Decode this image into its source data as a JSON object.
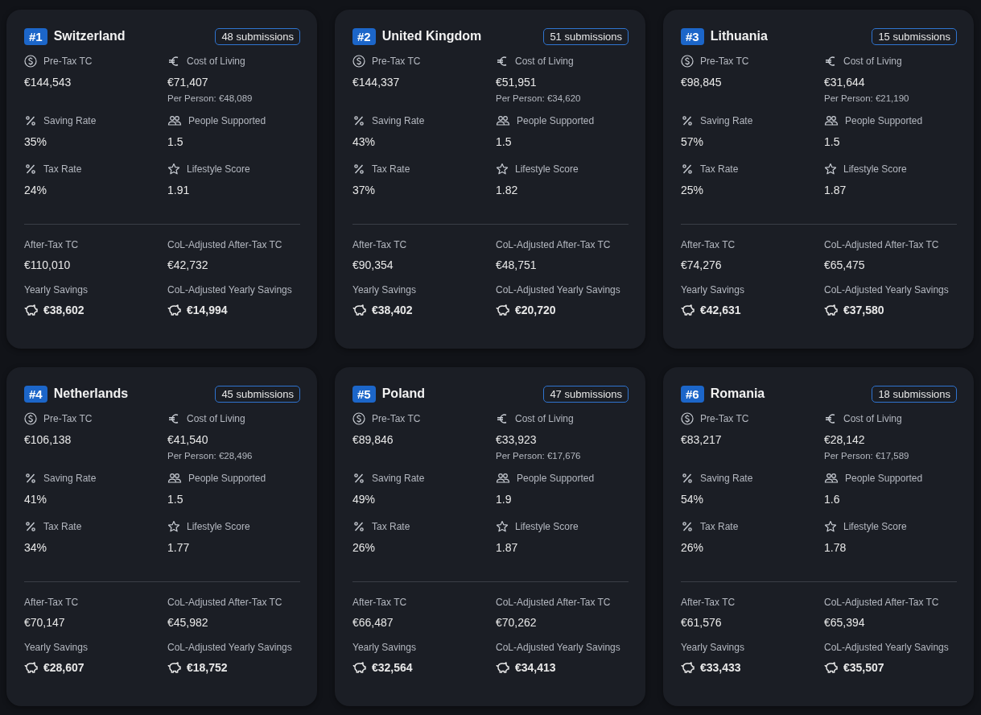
{
  "cards": [
    {
      "rank": "#1",
      "country": "Switzerland",
      "submissions": "48 submissions",
      "metrics": [
        {
          "kind": "dollar",
          "label": "Pre-Tax TC",
          "value": "€144,543"
        },
        {
          "kind": "euro",
          "label": "Cost of Living",
          "value": "€71,407",
          "note": "Per Person: €48,089"
        },
        {
          "kind": "percent",
          "label": "Saving Rate",
          "value": "35%"
        },
        {
          "kind": "people",
          "label": "People Supported",
          "value": "1.5"
        },
        {
          "kind": "percent",
          "label": "Tax Rate",
          "value": "24%"
        },
        {
          "kind": "star",
          "label": "Lifestyle Score",
          "value": "1.91"
        }
      ],
      "totals": [
        {
          "kind": "plain",
          "label": "After-Tax TC",
          "value": "€110,010"
        },
        {
          "kind": "plain",
          "label": "CoL-Adjusted After-Tax TC",
          "value": "€42,732"
        },
        {
          "kind": "savings",
          "label": "Yearly Savings",
          "value": "€38,602"
        },
        {
          "kind": "savings",
          "label": "CoL-Adjusted Yearly Savings",
          "value": "€14,994"
        }
      ]
    },
    {
      "rank": "#2",
      "country": "United Kingdom",
      "submissions": "51 submissions",
      "metrics": [
        {
          "kind": "dollar",
          "label": "Pre-Tax TC",
          "value": "€144,337"
        },
        {
          "kind": "euro",
          "label": "Cost of Living",
          "value": "€51,951",
          "note": "Per Person: €34,620"
        },
        {
          "kind": "percent",
          "label": "Saving Rate",
          "value": "43%"
        },
        {
          "kind": "people",
          "label": "People Supported",
          "value": "1.5"
        },
        {
          "kind": "percent",
          "label": "Tax Rate",
          "value": "37%"
        },
        {
          "kind": "star",
          "label": "Lifestyle Score",
          "value": "1.82"
        }
      ],
      "totals": [
        {
          "kind": "plain",
          "label": "After-Tax TC",
          "value": "€90,354"
        },
        {
          "kind": "plain",
          "label": "CoL-Adjusted After-Tax TC",
          "value": "€48,751"
        },
        {
          "kind": "savings",
          "label": "Yearly Savings",
          "value": "€38,402"
        },
        {
          "kind": "savings",
          "label": "CoL-Adjusted Yearly Savings",
          "value": "€20,720"
        }
      ]
    },
    {
      "rank": "#3",
      "country": "Lithuania",
      "submissions": "15 submissions",
      "metrics": [
        {
          "kind": "dollar",
          "label": "Pre-Tax TC",
          "value": "€98,845"
        },
        {
          "kind": "euro",
          "label": "Cost of Living",
          "value": "€31,644",
          "note": "Per Person: €21,190"
        },
        {
          "kind": "percent",
          "label": "Saving Rate",
          "value": "57%"
        },
        {
          "kind": "people",
          "label": "People Supported",
          "value": "1.5"
        },
        {
          "kind": "percent",
          "label": "Tax Rate",
          "value": "25%"
        },
        {
          "kind": "star",
          "label": "Lifestyle Score",
          "value": "1.87"
        }
      ],
      "totals": [
        {
          "kind": "plain",
          "label": "After-Tax TC",
          "value": "€74,276"
        },
        {
          "kind": "plain",
          "label": "CoL-Adjusted After-Tax TC",
          "value": "€65,475"
        },
        {
          "kind": "savings",
          "label": "Yearly Savings",
          "value": "€42,631"
        },
        {
          "kind": "savings",
          "label": "CoL-Adjusted Yearly Savings",
          "value": "€37,580"
        }
      ]
    },
    {
      "rank": "#4",
      "country": "Netherlands",
      "submissions": "45 submissions",
      "metrics": [
        {
          "kind": "dollar",
          "label": "Pre-Tax TC",
          "value": "€106,138"
        },
        {
          "kind": "euro",
          "label": "Cost of Living",
          "value": "€41,540",
          "note": "Per Person: €28,496"
        },
        {
          "kind": "percent",
          "label": "Saving Rate",
          "value": "41%"
        },
        {
          "kind": "people",
          "label": "People Supported",
          "value": "1.5"
        },
        {
          "kind": "percent",
          "label": "Tax Rate",
          "value": "34%"
        },
        {
          "kind": "star",
          "label": "Lifestyle Score",
          "value": "1.77"
        }
      ],
      "totals": [
        {
          "kind": "plain",
          "label": "After-Tax TC",
          "value": "€70,147"
        },
        {
          "kind": "plain",
          "label": "CoL-Adjusted After-Tax TC",
          "value": "€45,982"
        },
        {
          "kind": "savings",
          "label": "Yearly Savings",
          "value": "€28,607"
        },
        {
          "kind": "savings",
          "label": "CoL-Adjusted Yearly Savings",
          "value": "€18,752"
        }
      ]
    },
    {
      "rank": "#5",
      "country": "Poland",
      "submissions": "47 submissions",
      "metrics": [
        {
          "kind": "dollar",
          "label": "Pre-Tax TC",
          "value": "€89,846"
        },
        {
          "kind": "euro",
          "label": "Cost of Living",
          "value": "€33,923",
          "note": "Per Person: €17,676"
        },
        {
          "kind": "percent",
          "label": "Saving Rate",
          "value": "49%"
        },
        {
          "kind": "people",
          "label": "People Supported",
          "value": "1.9"
        },
        {
          "kind": "percent",
          "label": "Tax Rate",
          "value": "26%"
        },
        {
          "kind": "star",
          "label": "Lifestyle Score",
          "value": "1.87"
        }
      ],
      "totals": [
        {
          "kind": "plain",
          "label": "After-Tax TC",
          "value": "€66,487"
        },
        {
          "kind": "plain",
          "label": "CoL-Adjusted After-Tax TC",
          "value": "€70,262"
        },
        {
          "kind": "savings",
          "label": "Yearly Savings",
          "value": "€32,564"
        },
        {
          "kind": "savings",
          "label": "CoL-Adjusted Yearly Savings",
          "value": "€34,413"
        }
      ]
    },
    {
      "rank": "#6",
      "country": "Romania",
      "submissions": "18 submissions",
      "metrics": [
        {
          "kind": "dollar",
          "label": "Pre-Tax TC",
          "value": "€83,217"
        },
        {
          "kind": "euro",
          "label": "Cost of Living",
          "value": "€28,142",
          "note": "Per Person: €17,589"
        },
        {
          "kind": "percent",
          "label": "Saving Rate",
          "value": "54%"
        },
        {
          "kind": "people",
          "label": "People Supported",
          "value": "1.6"
        },
        {
          "kind": "percent",
          "label": "Tax Rate",
          "value": "26%"
        },
        {
          "kind": "star",
          "label": "Lifestyle Score",
          "value": "1.78"
        }
      ],
      "totals": [
        {
          "kind": "plain",
          "label": "After-Tax TC",
          "value": "€61,576"
        },
        {
          "kind": "plain",
          "label": "CoL-Adjusted After-Tax TC",
          "value": "€65,394"
        },
        {
          "kind": "savings",
          "label": "Yearly Savings",
          "value": "€33,433"
        },
        {
          "kind": "savings",
          "label": "CoL-Adjusted Yearly Savings",
          "value": "€35,507"
        }
      ]
    }
  ]
}
